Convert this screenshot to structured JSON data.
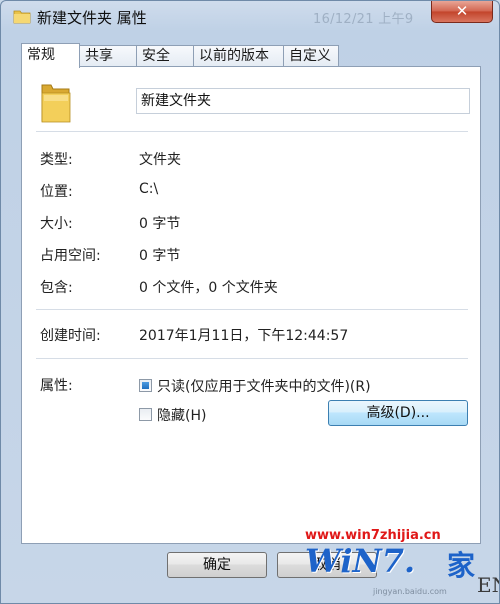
{
  "window": {
    "title": "新建文件夹 属性",
    "close_label": "✕"
  },
  "background": {
    "timestamp_text": "16/12/21 上午9",
    "en_text": "EN"
  },
  "tabs": [
    {
      "label": "常规",
      "active": true
    },
    {
      "label": "共享",
      "active": false
    },
    {
      "label": "安全",
      "active": false
    },
    {
      "label": "以前的版本",
      "active": false
    },
    {
      "label": "自定义",
      "active": false
    }
  ],
  "general": {
    "folder_name": "新建文件夹",
    "rows": [
      {
        "label": "类型:",
        "value": "文件夹"
      },
      {
        "label": "位置:",
        "value": "C:\\"
      },
      {
        "label": "大小:",
        "value": "0 字节"
      },
      {
        "label": "占用空间:",
        "value": "0 字节"
      },
      {
        "label": "包含:",
        "value": "0 个文件，0 个文件夹"
      }
    ],
    "created": {
      "label": "创建时间:",
      "value": "2017年1月11日，下午12:44:57"
    },
    "attributes": {
      "label": "属性:",
      "readonly_label": "只读(仅应用于文件夹中的文件)(R)",
      "readonly_state": "indeterminate",
      "hidden_label": "隐藏(H)",
      "hidden_state": "unchecked",
      "advanced_button": "高级(D)..."
    }
  },
  "footer": {
    "ok_label": "确定",
    "cancel_label": "取消"
  },
  "watermark": {
    "url_text": "www.win7zhijia.cn",
    "logo_text": "WiN7.",
    "logo_jia": "家",
    "sub_text": "jingyan.baidu.com"
  },
  "colors": {
    "accent": "#1d63c9",
    "close": "#c2432a",
    "watermark": "#e01818",
    "folder": "#e8c24a"
  }
}
